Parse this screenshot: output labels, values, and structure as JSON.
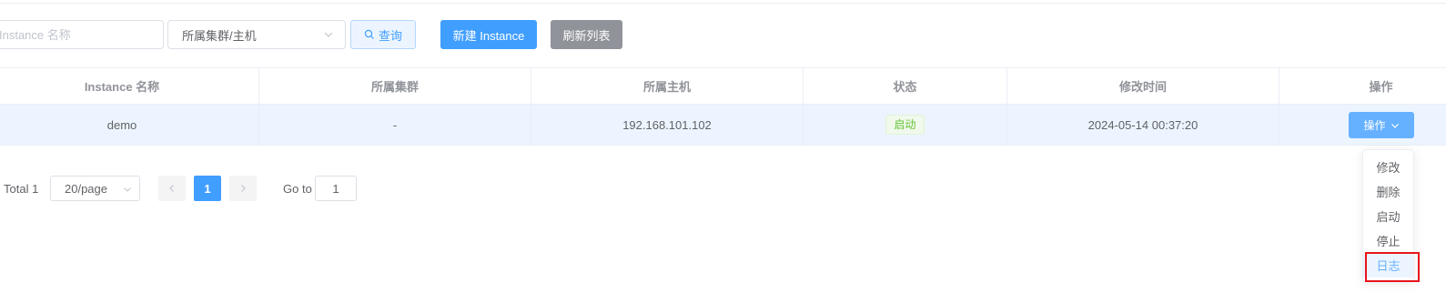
{
  "toolbar": {
    "name_placeholder": "Instance 名称",
    "select_value": "所属集群/主机",
    "query_label": "查询",
    "new_label": "新建 Instance",
    "refresh_label": "刷新列表"
  },
  "table": {
    "columns": [
      "Instance 名称",
      "所属集群",
      "所属主机",
      "状态",
      "修改时间",
      "操作"
    ],
    "rows": [
      {
        "name": "demo",
        "cluster": "-",
        "host": "192.168.101.102",
        "status": "启动",
        "modified": "2024-05-14 00:37:20",
        "action_label": "操作"
      }
    ]
  },
  "pagination": {
    "total_label": "Total 1",
    "page_size": "20/page",
    "current_page": "1",
    "goto_label": "Go to",
    "goto_value": "1"
  },
  "dropdown": {
    "items": [
      "修改",
      "删除",
      "启动",
      "停止",
      "日志"
    ],
    "active_item": "日志"
  },
  "colors": {
    "primary": "#409eff",
    "success": "#67c23a",
    "highlight_box": "#e8151b"
  }
}
